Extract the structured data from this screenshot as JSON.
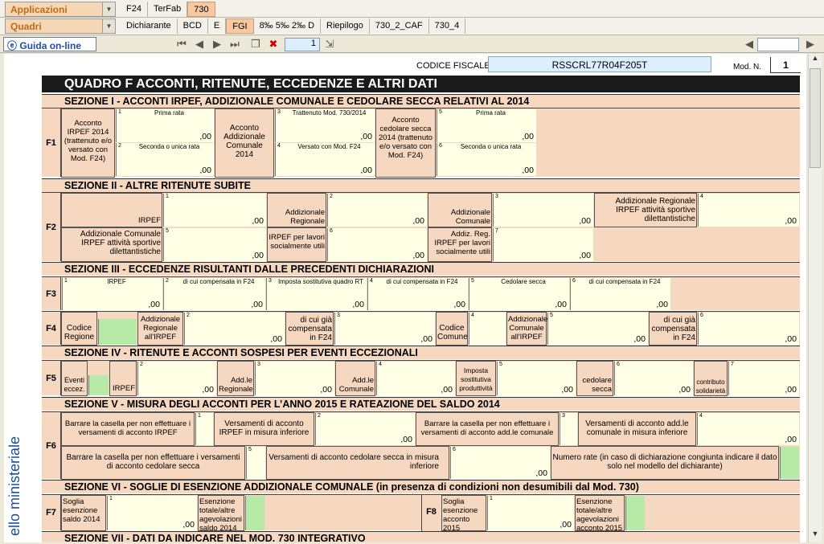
{
  "menus": {
    "applicazioni": "Applicazioni",
    "quadri": "Quadri"
  },
  "tabs_top": [
    "F24",
    "TerFab",
    "730"
  ],
  "tabs_quadri": [
    "Dichiarante",
    "BCD",
    "E",
    "FGI",
    "8‰ 5‰ 2‰ D",
    "Riepilogo",
    "730_2_CAF",
    "730_4"
  ],
  "toolbar": {
    "guide": "Guida on-line",
    "page": "1"
  },
  "doc": {
    "side_text": "ello ministeriale",
    "cf_label": "CODICE FISCALE",
    "cf_value": "RSSCRL77R04F205T",
    "mod_label": "Mod. N.",
    "mod_value": "1",
    "title": "QUADRO F ACCONTI, RITENUTE, ECCEDENZE E ALTRI DATI",
    "sec1": "SEZIONE I - ACCONTI IRPEF, ADDIZIONALE COMUNALE E CEDOLARE SECCA RELATIVI AL 2014",
    "sec2": "SEZIONE II - ALTRE RITENUTE SUBITE",
    "sec3": "SEZIONE III - ECCEDENZE RISULTANTI DALLE PRECEDENTI DICHIARAZIONI",
    "sec4": "SEZIONE IV - RITENUTE E ACCONTI SOSPESI PER EVENTI ECCEZIONALI",
    "sec5": "SEZIONE V - MISURA DEGLI ACCONTI PER L’ANNO 2015 E RATEAZIONE DEL SALDO 2014",
    "sec6": "SEZIONE VI - SOGLIE DI ESENZIONE ADDIZIONALE COMUNALE",
    "sec6b": "(in presenza di condizioni non desumibili dal Mod. 730)",
    "sec7": "SEZIONE VII - DATI DA INDICARE NEL MOD. 730 INTEGRATIVO",
    "zero": ",00",
    "f1": {
      "a": "Acconto IRPEF 2014 (trattenuto e/o versato con Mod. F24)",
      "p1": "Prima rata",
      "p2": "Seconda o unica rata",
      "b": "Acconto Addizionale Comunale 2014",
      "p3": "Trattenuto Mod. 730/2014",
      "p4": "Versato con Mod. F24",
      "c": "Acconto cedolare secca 2014 (trattenuto e/o versato con Mod. F24)",
      "p5": "Prima rata",
      "p6": "Seconda o unica rata"
    },
    "f2": {
      "l1": "IRPEF",
      "l2": "Addizionale Regionale",
      "l3": "Addizionale Comunale",
      "l4": "Addizionale Regionale IRPEF attività sportive dilettantistiche",
      "l5": "Addizionale Comunale IRPEF attività sportive dilettantistiche",
      "l6": "IRPEF per lavori socialmente utili",
      "l7": "Addiz. Reg. IRPEF per lavori socialmente utili"
    },
    "f3": {
      "l1": "IRPEF",
      "l2": "di cui compensata in F24",
      "l3": "Imposta sostitutiva quadro RT",
      "l4": "di cui compensata in F24",
      "l5": "Cedolare secca",
      "l6": "di cui compensata in F24"
    },
    "f4": {
      "l1": "Codice Regione",
      "l2": "Addizionale Regionale all'IRPEF",
      "l3": "di cui già compensata in F24",
      "l4": "Codice Comune",
      "l5": "Addizionale Comunale all'IRPEF",
      "l6": "di cui già compensata in F24"
    },
    "f5": {
      "l1": "Eventi eccez.",
      "l2": "IRPEF",
      "l3": "Add.le Regionale",
      "l4": "Add.le Comunale",
      "l5": "Imposta sostitutiva produttività",
      "l6": "cedolare secca",
      "l7": "contributo solidarietà"
    },
    "f6": {
      "l1": "Barrare la casella per non effettuare i versamenti di acconto IRPEF",
      "l2": "Versamenti di acconto IRPEF in misura inferiore",
      "l3": "Barrare la casella per non effettuare i versamenti di acconto add.le comunale",
      "l4": "Versamenti di acconto add.le comunale in misura inferiore",
      "l5": "Barrare la casella per non effettuare i versamenti di acconto cedolare secca",
      "l6": "Versamenti di acconto cedolare secca in misura inferiore",
      "l7": "Numero rate (in caso di dichiarazione congiunta indicare il dato solo nel modello del dichiarante)"
    },
    "f7": {
      "l1": "Soglia esenzione saldo 2014",
      "l2": "Esenzione totale/altre agevolazioni saldo 2014"
    },
    "f8": {
      "l1": "Soglia esenzione acconto 2015",
      "l2": "Esenzione totale/altre agevolazioni acconto 2015"
    }
  }
}
